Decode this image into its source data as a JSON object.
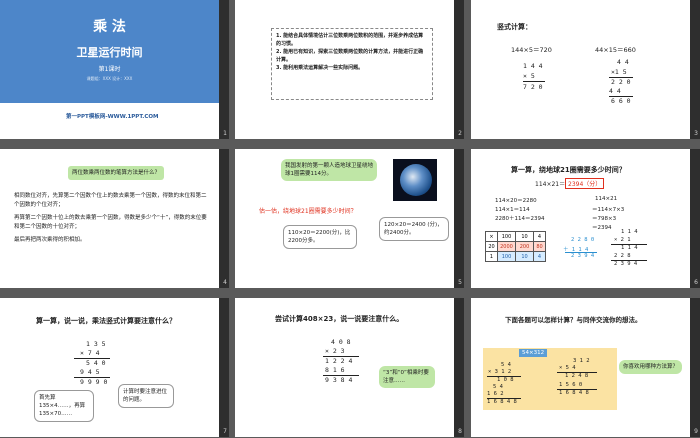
{
  "slides": [
    {
      "num": "1",
      "title": "乘 法",
      "subtitle": "卫星运行时间",
      "lesson": "第1课时",
      "credit": "课题组：XXX   设计：XXX",
      "site": "第一PPT模板网-WWW.1PPT.COM"
    },
    {
      "num": "2",
      "objectives": [
        "1. 能结合具体情境估计三位数乘两位数积的范围，并逐步养成估算的习惯。",
        "2. 能用已有知识，探索三位数乘两位数的计算方法，并能进行正确计算。",
        "3. 能利用乘法运算解决一些实际问题。"
      ]
    },
    {
      "num": "3",
      "heading": "竖式计算：",
      "eq1": "144×5＝720",
      "eq2": "44×15＝660",
      "c1": [
        "1 4 4",
        "×  5",
        "7 2 0"
      ],
      "c2": [
        "4 4",
        "×1 5",
        "2 2 0",
        "4 4",
        "6 6 0"
      ]
    },
    {
      "num": "4",
      "question": "两位数乘两位数的笔算方法是什么？",
      "body": [
        "相同数位对齐，先算第二个因数个位上的数去乘第一个因数，得数的末位和第二个因数的个位对齐；",
        "再算第二个因数十位上的数去乘第一个因数，得数是多少个“十”，得数的末位要和第二个因数的十位对齐；",
        "最后再把两次乘得的积相加。"
      ]
    },
    {
      "num": "5",
      "callout": "我国发射的第一颗人造地球卫星绕地球1圈需要114分。",
      "question": "估一估，绕地球21圈需要多少时间？",
      "est1": "110×20＝2200(分)，比2200分多。",
      "est2": "120×20＝2400 (分)，约2400分。"
    },
    {
      "num": "6",
      "heading": "算一算，绕地球21圈需要多少时间？",
      "eq": "114×21＝",
      "answer": "2394（分）",
      "steps": [
        "114×20＝2280",
        "114×1＝114",
        "2280＋114＝2394"
      ],
      "alt": [
        "114×21",
        "＝114×7×3",
        "＝798×3",
        "＝2394"
      ],
      "table": [
        [
          "×",
          "100",
          "10",
          "4"
        ],
        [
          "20",
          "2000",
          "200",
          "80"
        ],
        [
          "1",
          "100",
          "10",
          "4"
        ]
      ],
      "sum": [
        "2 2 8 0",
        "＋   1 1 4",
        "2 3 9 4"
      ],
      "vert": [
        "1 1 4",
        "×  2 1",
        "1 1 4",
        "2 2 8",
        "2 3 9 4"
      ]
    },
    {
      "num": "7",
      "heading": "算一算，说一说，乘法竖式计算要注意什么？",
      "calc": [
        "1 3 5",
        "×  7 4",
        "5 4 0",
        "9 4 5",
        "9 9 9 0"
      ],
      "note1": "首先算135×4……，再算135×70……",
      "note2": "计算时要注意进位的问题。"
    },
    {
      "num": "8",
      "heading": "尝试计算408×23，说一说要注意什么。",
      "calc": [
        "4 0 8",
        "×  2 3",
        "1 2 2 4",
        "8 1 6",
        "9 3 8 4"
      ],
      "note": "“3”和“0”相乘时要注意……"
    },
    {
      "num": "9",
      "heading": "下面各题可以怎样计算？与同伴交流你的想法。",
      "label": "54×312",
      "c1": [
        "5 4",
        "× 3 1 2",
        "1 0 8",
        "5 4",
        "1 6 2",
        "1 6 8 4 8"
      ],
      "c2": [
        "3 1 2",
        "×   5 4",
        "1 2 4 8",
        "1 5 6 0",
        "1 6 8 4 8"
      ],
      "ask": "你喜欢用哪种方法算？"
    }
  ]
}
